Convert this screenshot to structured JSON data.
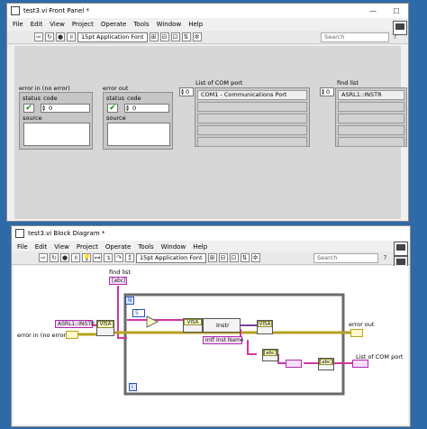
{
  "front_panel": {
    "title": "test3.vi Front Panel *",
    "menu": [
      "File",
      "Edit",
      "View",
      "Project",
      "Operate",
      "Tools",
      "Window",
      "Help"
    ],
    "font_select": "15pt Application Font",
    "search_placeholder": "Search",
    "error_in": {
      "label": "error in (no error)",
      "status_label": "status",
      "code_label": "code",
      "code_value": "0",
      "source_label": "source",
      "status_glyph": "✔"
    },
    "error_out": {
      "label": "error out",
      "status_label": "status",
      "code_label": "code",
      "code_value": "0",
      "source_label": "source",
      "status_glyph": "✔"
    },
    "com_list": {
      "label": "List of COM port",
      "index": "0",
      "items": [
        "COM1 - Communications Port",
        "",
        "",
        "",
        ""
      ]
    },
    "find_list": {
      "label": "find list",
      "index": "0",
      "items": [
        "ASRL1::INSTR",
        "",
        "",
        "",
        ""
      ]
    }
  },
  "block_diagram": {
    "title": "test3.vi Block Diagram *",
    "menu": [
      "File",
      "Edit",
      "View",
      "Project",
      "Operate",
      "Tools",
      "Window",
      "Help"
    ],
    "font_select": "15pt Application Font",
    "search_placeholder": "Search",
    "labels": {
      "find_list": "find list",
      "find_list_term": "[abc]",
      "asrl_const": "ASRL1::INSTR",
      "error_in": "error in (no error)",
      "error_out": "error out",
      "list_com": "List of COM port",
      "instr": "Instr",
      "intf_inst_name": "Intf Inst Name",
      "n_term": "N",
      "i_term": "i",
      "shift_const": "5",
      "node_find": "VISA",
      "node_open": "VISA",
      "node_close": "VISA",
      "node_a": "[abc]",
      "node_b": "[abc]"
    }
  },
  "colors": {
    "desktop": "#2f6aa8",
    "panel_bg": "#d7d7d7",
    "string_wire": "#d0369f",
    "error_wire": "#b5a21e",
    "visa_wire": "#7a3fa0",
    "status_green": "#1a8a1a"
  }
}
